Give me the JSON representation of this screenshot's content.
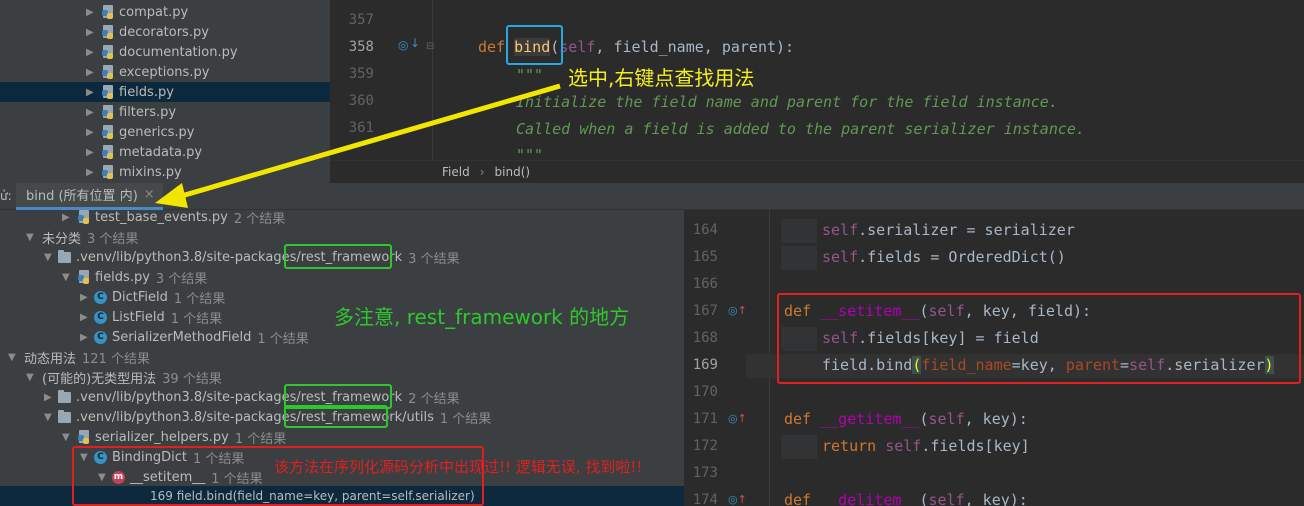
{
  "project_tree": {
    "files": [
      "compat.py",
      "decorators.py",
      "documentation.py",
      "exceptions.py",
      "fields.py",
      "filters.py",
      "generics.py",
      "metadata.py",
      "mixins.py"
    ],
    "selected": "fields.py"
  },
  "top_editor": {
    "line_numbers": [
      "357",
      "358",
      "359",
      "360",
      "361"
    ],
    "current_line": "358",
    "code": {
      "l358_def": "def ",
      "l358_name": "bind",
      "l358_rest": "(",
      "l358_self": "self",
      "l358_args": ", field_name, parent):",
      "l359": "\"\"\"",
      "l360": "Initialize the field name and parent for the field instance.",
      "l361": "Called when a field is added to the parent serializer instance.",
      "l362": "\"\"\""
    }
  },
  "breadcrumb": {
    "class": "Field",
    "method": "bind()"
  },
  "find_panel": {
    "prefix": "ử:",
    "tab_label": "bind (所有位置 内)",
    "close": "×"
  },
  "results": {
    "rows": [
      {
        "text": "test_base_events.py",
        "count": "2 个结果"
      },
      {
        "text": "未分类",
        "count": "3 个结果"
      },
      {
        "text": ".venv/lib/python3.8/site-packages/rest_framework",
        "count": "3 个结果"
      },
      {
        "text": "fields.py",
        "count": "3 个结果"
      },
      {
        "text": "DictField",
        "count": "1 个结果"
      },
      {
        "text": "ListField",
        "count": "1 个结果"
      },
      {
        "text": "SerializerMethodField",
        "count": "1 个结果"
      },
      {
        "text": "动态用法",
        "count": "121 个结果"
      },
      {
        "text": "(可能的)无类型用法",
        "count": "39 个结果"
      },
      {
        "text": ".venv/lib/python3.8/site-packages/rest_framework",
        "count": "2 个结果"
      },
      {
        "text": ".venv/lib/python3.8/site-packages/rest_framework/utils",
        "count": "1 个结果"
      },
      {
        "text": "serializer_helpers.py",
        "count": "1 个结果"
      },
      {
        "text": "BindingDict",
        "count": "1 个结果"
      },
      {
        "text": "__setitem__",
        "count": "1 个结果"
      },
      {
        "text": "169 field.bind(field_name=key, parent=self.serializer)",
        "count": ""
      }
    ]
  },
  "preview": {
    "line_numbers": [
      "164",
      "165",
      "166",
      "167",
      "168",
      "169",
      "170",
      "171",
      "172",
      "173",
      "174"
    ],
    "current_line": "169"
  },
  "annotations": {
    "right_click_note": "选中,右键点查找用法",
    "rest_framework_note": "多注意, rest_framework 的地方",
    "found_note": "该方法在序列化源码分析中出现过!! 逻辑无误, 找到啦!!"
  },
  "colors": {
    "arrow": "#f2e600",
    "blue_box": "#28a8e0",
    "green_box": "#2ec82e",
    "red_box": "#e02020"
  }
}
